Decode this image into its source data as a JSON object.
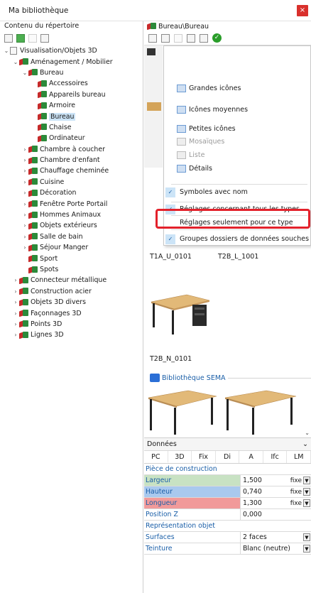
{
  "window": {
    "title": "Ma bibliothèque",
    "close_symbol": "×"
  },
  "left_pane": {
    "header": "Contenu du répertoire",
    "tree": [
      {
        "label": "Visualisation/Objets 3D",
        "level": 0,
        "expanded": true,
        "icon": "doc"
      },
      {
        "label": "Aménagement / Mobilier",
        "level": 1,
        "expanded": true,
        "icon": "folder3d"
      },
      {
        "label": "Bureau",
        "level": 2,
        "expanded": true,
        "icon": "folder3d"
      },
      {
        "label": "Accessoires",
        "level": 3,
        "icon": "folder3d"
      },
      {
        "label": "Appareils bureau",
        "level": 3,
        "icon": "folder3d"
      },
      {
        "label": "Armoire",
        "level": 3,
        "icon": "folder3d"
      },
      {
        "label": "Bureau",
        "level": 3,
        "icon": "folder3d",
        "selected": true
      },
      {
        "label": "Chaise",
        "level": 3,
        "icon": "folder3d"
      },
      {
        "label": "Ordinateur",
        "level": 3,
        "icon": "folder3d"
      },
      {
        "label": "Chambre à coucher",
        "level": 2,
        "collapsed": true,
        "icon": "folder3d"
      },
      {
        "label": "Chambre d'enfant",
        "level": 2,
        "collapsed": true,
        "icon": "folder3d"
      },
      {
        "label": "Chauffage cheminée",
        "level": 2,
        "collapsed": true,
        "icon": "folder3d"
      },
      {
        "label": "Cuisine",
        "level": 2,
        "collapsed": true,
        "icon": "folder3d"
      },
      {
        "label": "Décoration",
        "level": 2,
        "collapsed": true,
        "icon": "folder3d"
      },
      {
        "label": "Fenêtre Porte Portail",
        "level": 2,
        "collapsed": true,
        "icon": "folder3d"
      },
      {
        "label": "Hommes Animaux",
        "level": 2,
        "collapsed": true,
        "icon": "folder3d"
      },
      {
        "label": "Objets extérieurs",
        "level": 2,
        "collapsed": true,
        "icon": "folder3d"
      },
      {
        "label": "Salle de bain",
        "level": 2,
        "collapsed": true,
        "icon": "folder3d"
      },
      {
        "label": "Séjour Manger",
        "level": 2,
        "collapsed": true,
        "icon": "folder3d"
      },
      {
        "label": "Sport",
        "level": 2,
        "icon": "folder3d"
      },
      {
        "label": "Spots",
        "level": 2,
        "icon": "folder3d"
      },
      {
        "label": "Connecteur métallique",
        "level": 1,
        "collapsed": true,
        "icon": "folder3d"
      },
      {
        "label": "Construction acier",
        "level": 1,
        "collapsed": true,
        "icon": "folder3d"
      },
      {
        "label": "Objets 3D divers",
        "level": 1,
        "collapsed": true,
        "icon": "folder3d"
      },
      {
        "label": "Façonnages 3D",
        "level": 1,
        "collapsed": true,
        "icon": "folder3d"
      },
      {
        "label": "Points 3D",
        "level": 1,
        "collapsed": true,
        "icon": "folder3d"
      },
      {
        "label": "Lignes 3D",
        "level": 1,
        "collapsed": true,
        "icon": "folder3d"
      }
    ]
  },
  "right_pane": {
    "path": "Bureau\\Bureau",
    "menu": {
      "view_options": [
        {
          "label": "Grandes icônes",
          "enabled": true
        },
        {
          "label": "Icônes moyennes",
          "enabled": true
        },
        {
          "label": "Petites icônes",
          "enabled": true
        },
        {
          "label": "Mosaïques",
          "enabled": false
        },
        {
          "label": "Liste",
          "enabled": false
        },
        {
          "label": "Détails",
          "enabled": true
        }
      ],
      "toggles": [
        {
          "label": "Symboles avec nom",
          "checked": true
        },
        {
          "label": "Réglages concernant tous les types",
          "checked": true
        },
        {
          "label": "Réglages seulement pour ce type",
          "checked": false
        },
        {
          "label": "Groupes dossiers de données souches",
          "checked": true
        }
      ]
    },
    "items": [
      {
        "label": "T1A_U_0101"
      },
      {
        "label": "T2B_L_1001"
      },
      {
        "label": "T2B_N_0101"
      }
    ],
    "section_title": "Bibliothèque SEMA"
  },
  "properties": {
    "header": "Données",
    "tabs": [
      "PC",
      "3D",
      "Fix",
      "Di",
      "A",
      "Ifc",
      "LM"
    ],
    "active_tab": "PC",
    "group1": "Pièce de construction",
    "rows1": [
      {
        "label": "Largeur",
        "value": "1,500",
        "unit": "fixe",
        "color": "#c8e2c3",
        "dropdown": true
      },
      {
        "label": "Hauteur",
        "value": "0,740",
        "unit": "fixe",
        "color": "#a9c9ee",
        "dropdown": true
      },
      {
        "label": "Longueur",
        "value": "1,300",
        "unit": "fixe",
        "color": "#f19a9a",
        "dropdown": true
      },
      {
        "label": "Position Z",
        "value": "0,000",
        "unit": "",
        "color": "",
        "dropdown": false
      }
    ],
    "group2": "Représentation objet",
    "rows2": [
      {
        "label": "Surfaces",
        "value": "2 faces",
        "unit": "",
        "color": "",
        "dropdown": true
      },
      {
        "label": "Teinture",
        "value": "Blanc (neutre)",
        "unit": "",
        "color": "",
        "dropdown": true
      }
    ]
  },
  "colors": {
    "highlight": "#e3212b",
    "selection": "#cce4f7",
    "accent": "#1b5fa8"
  },
  "icons": {
    "folder3d": "3d-folder-icon",
    "doc": "document-icon",
    "close": "close-icon"
  }
}
